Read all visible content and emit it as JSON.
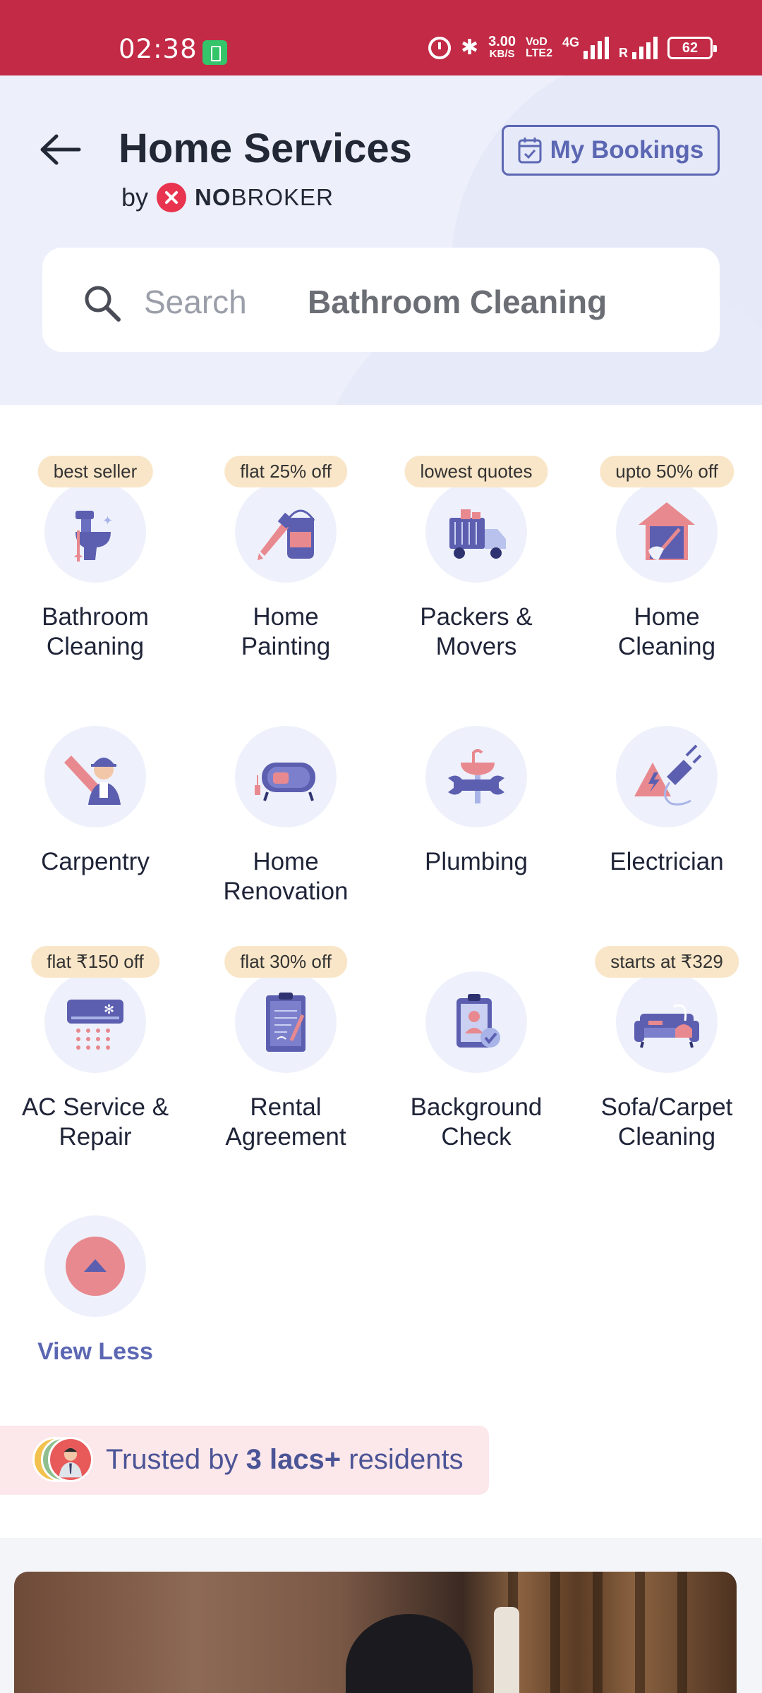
{
  "status_bar": {
    "time": "02:38",
    "speed": "3.00",
    "speed_unit": "KB/S",
    "volte_top": "VoD",
    "volte_bottom": "LTE2",
    "network": "4G",
    "roaming": "R",
    "battery": "62"
  },
  "header": {
    "title": "Home Services",
    "by": "by",
    "brand_bold": "NO",
    "brand_rest": "BROKER",
    "bookings_label": "My Bookings"
  },
  "search": {
    "label": "Search",
    "term": "Bathroom Cleaning"
  },
  "services": [
    {
      "line1": "Bathroom",
      "line2": "Cleaning",
      "badge": "best seller",
      "icon": "toilet-icon"
    },
    {
      "line1": "Home",
      "line2": "Painting",
      "badge": "flat 25% off",
      "icon": "paint-bucket-icon"
    },
    {
      "line1": "Packers &",
      "line2": "Movers",
      "badge": "lowest quotes",
      "icon": "truck-icon"
    },
    {
      "line1": "Home",
      "line2": "Cleaning",
      "badge": "upto 50% off",
      "icon": "house-broom-icon"
    },
    {
      "line1": "Carpentry",
      "line2": "",
      "badge": "",
      "icon": "carpenter-icon"
    },
    {
      "line1": "Home",
      "line2": "Renovation",
      "badge": "",
      "icon": "sofa-renovation-icon"
    },
    {
      "line1": "Plumbing",
      "line2": "",
      "badge": "",
      "icon": "wrench-sink-icon"
    },
    {
      "line1": "Electrician",
      "line2": "",
      "badge": "",
      "icon": "electric-plug-icon"
    },
    {
      "line1": "AC Service &",
      "line2": "Repair",
      "badge": "flat ₹150 off",
      "icon": "air-conditioner-icon"
    },
    {
      "line1": "Rental",
      "line2": "Agreement",
      "badge": "flat 30% off",
      "icon": "agreement-document-icon"
    },
    {
      "line1": "Background",
      "line2": "Check",
      "badge": "",
      "icon": "id-check-icon"
    },
    {
      "line1": "Sofa/Carpet",
      "line2": "Cleaning",
      "badge": "starts at ₹329",
      "icon": "sofa-cleaning-icon"
    }
  ],
  "view_less": {
    "label": "View Less"
  },
  "trust": {
    "prefix": "Trusted by ",
    "highlight": "3 lacs+",
    "suffix": " residents"
  },
  "colors": {
    "status_bar": "#c22a45",
    "accent": "#5c67b3",
    "badge_bg": "#f9e6c8",
    "icon_circle": "#eef1fb",
    "icon_pink": "#e8898f",
    "icon_blue": "#5c5fb0"
  }
}
